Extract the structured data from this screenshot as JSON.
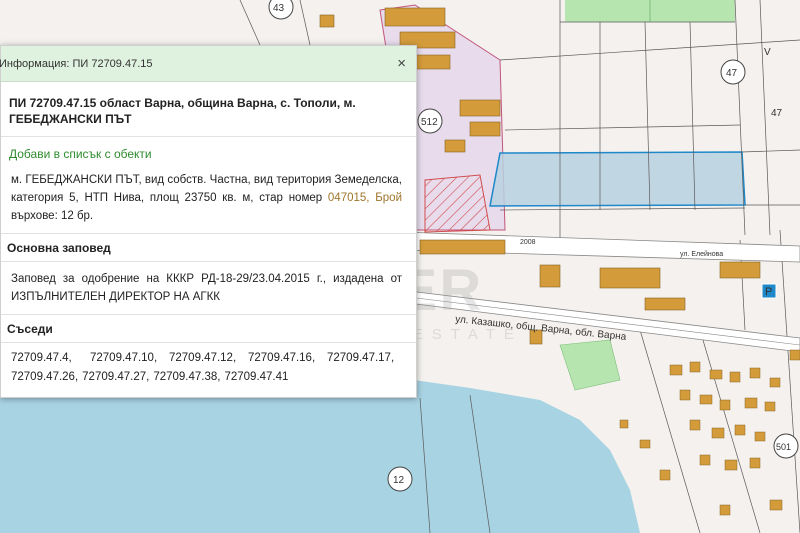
{
  "map": {
    "parcel_numbers": [
      "43",
      "512",
      "47",
      "47",
      "12",
      "501"
    ],
    "letter_v": "V",
    "street_labels": [
      "ул. Казашко, общ. Варна, обл. Варна",
      "2008",
      "ул. Елейнова"
    ],
    "colors": {
      "road": "#ffffff",
      "building": "#d39b3a",
      "green": "#b6e5b0",
      "water": "#a8d3e3",
      "selected": "#b7d1e0",
      "selected_border": "#1e88c9",
      "purple_zone": "#e8dcec",
      "hatch": "#d24b4b"
    },
    "watermark_main": "PREMIER",
    "watermark_sub": "REAL ESTATE"
  },
  "popup": {
    "title": "Информация: ПИ 72709.47.15",
    "close_symbol": "×",
    "heading": "ПИ 72709.47.15 област Варна, община Варна, с. Тополи, м. ГЕБЕДЖАНСКИ ПЪТ",
    "add_link": "Добави в списък с обекти",
    "desc_part1": "м. ГЕБЕДЖАНСКИ ПЪТ, вид собств. Частна, вид територия Земеделска, категория 5, НТП Нива, площ 23750 кв. м, стар номер ",
    "desc_old_number": "047015, Брой",
    "desc_part2": " върхове: 12 бр.",
    "order_title": "Основна заповед",
    "order_text": "Заповед за одобрение на КККР РД-18-29/23.04.2015 г., издадена от ИЗПЪЛНИТЕЛЕН ДИРЕКТОР НА АГКК",
    "neighbors_title": "Съседи",
    "neighbors": [
      "72709.47.4,",
      "72709.47.10,",
      "72709.47.12,",
      "72709.47.16,",
      "72709.47.17,",
      "72709.47.26,",
      "72709.47.27,",
      "72709.47.38,",
      "72709.47.41"
    ]
  }
}
